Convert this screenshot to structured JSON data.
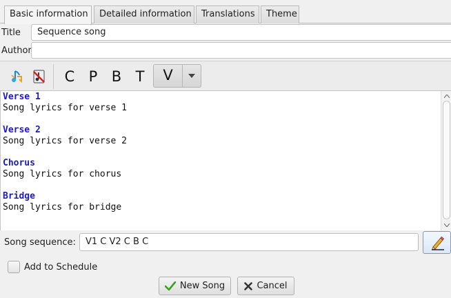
{
  "tabs": [
    {
      "label": "Basic information",
      "active": true
    },
    {
      "label": "Detailed information",
      "active": false
    },
    {
      "label": "Translations",
      "active": false
    },
    {
      "label": "Theme",
      "active": false
    }
  ],
  "form": {
    "title_label": "Title",
    "title_value": "Sequence song",
    "author_label": "Author",
    "author_value": ""
  },
  "toolbar": {
    "icons": [
      "transpose-icon",
      "remove-chords-icon"
    ],
    "section_buttons": [
      "C",
      "P",
      "B",
      "T"
    ],
    "split_button_label": "V"
  },
  "lyrics": {
    "sections": [
      {
        "title": "Verse 1",
        "line": "Song lyrics for verse 1"
      },
      {
        "title": "Verse 2",
        "line": "Song lyrics for verse 2"
      },
      {
        "title": "Chorus",
        "line": "Song lyrics for chorus"
      },
      {
        "title": "Bridge",
        "line": "Song lyrics for bridge"
      }
    ]
  },
  "sequence": {
    "label": "Song sequence:",
    "value": "V1 C V2 C B C"
  },
  "schedule": {
    "label": "Add to Schedule",
    "checked": false
  },
  "buttons": {
    "new_song": "New Song",
    "cancel": "Cancel"
  },
  "colors": {
    "section_title": "#1a1acc",
    "accent_border": "#6b9ed6",
    "check_green": "#3aa020",
    "cancel_x": "#333333"
  }
}
